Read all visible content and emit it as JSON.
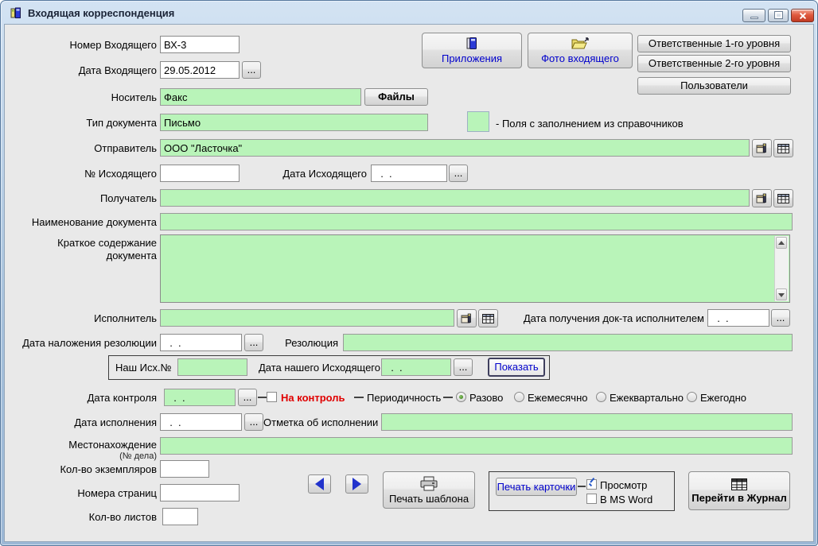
{
  "window": {
    "title": "Входящая корреспонденция"
  },
  "legend": {
    "text": "- Поля с заполнением из справочников"
  },
  "buttons": {
    "attachments": "Приложения",
    "photo_incoming": "Фото входящего",
    "responsible_level1": "Ответственные 1-го уровня",
    "responsible_level2": "Ответственные 2-го уровня",
    "users": "Пользователи",
    "files": "Файлы",
    "show": "Показать",
    "print_template": "Печать шаблона",
    "print_card": "Печать карточки",
    "goto_journal": "Перейти в Журнал",
    "ellipsis": "..."
  },
  "checkboxes": {
    "on_control": "На контроль",
    "preview": "Просмотр",
    "ms_word": "В MS Word"
  },
  "periodicity": {
    "label": "Периодичность",
    "options": [
      "Разово",
      "Ежемесячно",
      "Ежеквартально",
      "Ежегодно"
    ],
    "selected": "Разово"
  },
  "fields": {
    "incoming_number": {
      "label": "Номер Входящего",
      "value": "ВХ-3"
    },
    "incoming_date": {
      "label": "Дата Входящего",
      "value": "29.05.2012"
    },
    "carrier": {
      "label": "Носитель",
      "value": "Факс"
    },
    "doc_type": {
      "label": "Тип документа",
      "value": "Письмо"
    },
    "sender": {
      "label": "Отправитель",
      "value": "ООО \"Ласточка\""
    },
    "outgoing_number": {
      "label": "№ Исходящего",
      "value": ""
    },
    "outgoing_date": {
      "label": "Дата Исходящего",
      "value": "  .  ."
    },
    "recipient": {
      "label": "Получатель",
      "value": ""
    },
    "doc_name": {
      "label": "Наименование документа",
      "value": ""
    },
    "summary": {
      "label_line1": "Краткое содержание",
      "label_line2": "документа",
      "value": ""
    },
    "executor": {
      "label": "Исполнитель",
      "value": ""
    },
    "executor_received_date": {
      "label": "Дата получения док-та исполнителем",
      "value": "  .  ."
    },
    "resolution_date": {
      "label": "Дата наложения резолюции",
      "value": "  .  ."
    },
    "resolution": {
      "label": "Резолюция",
      "value": ""
    },
    "our_outgoing_number": {
      "label": "Наш Исх.№",
      "value": ""
    },
    "our_outgoing_date": {
      "label": "Дата нашего Исходящего",
      "value": "  .  ."
    },
    "control_date": {
      "label": "Дата контроля",
      "value": "  .  ."
    },
    "execution_date": {
      "label": "Дата исполнения",
      "value": "  .  ."
    },
    "execution_mark": {
      "label": "Отметка об исполнении",
      "value": ""
    },
    "location": {
      "label": "Местонахождение",
      "sublabel": "(№ дела)",
      "value": ""
    },
    "copies_count": {
      "label": "Кол-во экземпляров",
      "value": ""
    },
    "page_numbers": {
      "label": "Номера страниц",
      "value": ""
    },
    "sheets_count": {
      "label": "Кол-во листов",
      "value": ""
    }
  },
  "colors": {
    "reference_field": "#b9f4b9",
    "accent_blue": "#0000cc",
    "alert_red": "#e00000"
  }
}
